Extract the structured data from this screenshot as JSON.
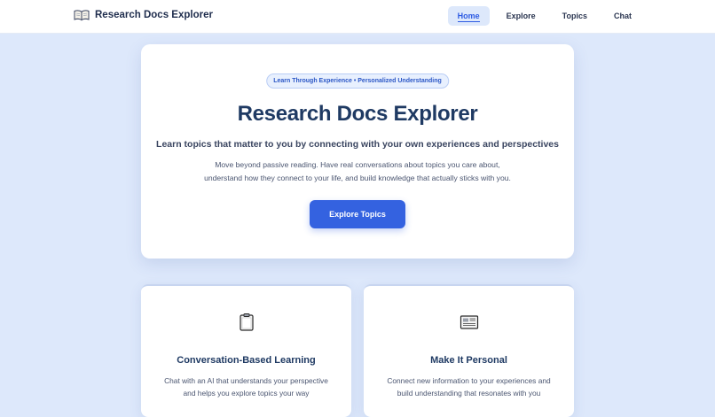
{
  "header": {
    "brand_icon": "open-book-icon",
    "title": "Research Docs Explorer",
    "nav": [
      {
        "label": "Home",
        "active": true
      },
      {
        "label": "Explore",
        "active": false
      },
      {
        "label": "Topics",
        "active": false
      },
      {
        "label": "Chat",
        "active": false
      }
    ]
  },
  "hero": {
    "badge": "Learn Through Experience • Personalized Understanding",
    "title": "Research Docs Explorer",
    "subtitle": "Learn topics that matter to you by connecting with your own experiences and perspectives",
    "description_lines": [
      "Move beyond passive reading. Have real conversations about topics you care about,",
      "understand how they connect to your life, and build knowledge that actually sticks with you."
    ],
    "cta_label": "Explore Topics"
  },
  "features": [
    {
      "icon": "clipboard-icon",
      "title": "Conversation-Based Learning",
      "description_lines": [
        "Chat with an AI that understands your perspective",
        "and helps you explore topics your way"
      ]
    },
    {
      "icon": "newspaper-icon",
      "title": "Make It Personal",
      "description_lines": [
        "Connect new information to your experiences and",
        "build understanding that resonates with you"
      ]
    }
  ],
  "colors": {
    "page_bg": "#dde8fb",
    "accent": "#3462e0",
    "title": "#1f3a63"
  }
}
